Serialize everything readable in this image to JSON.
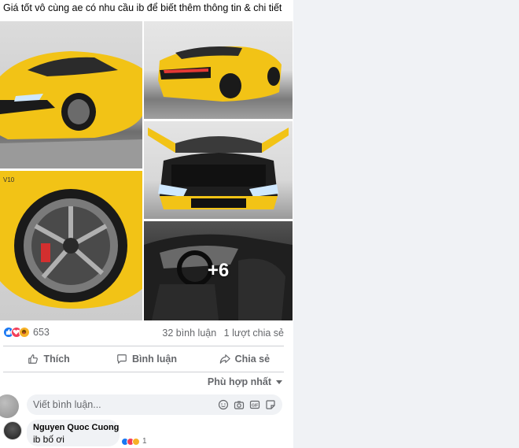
{
  "post": {
    "caption": "Giá tốt vô cùng ae có nhu cầu ib để biết thêm thông tin & chi tiết",
    "photos": [
      {
        "icon": "car-front-photo"
      },
      {
        "icon": "car-rear-photo"
      },
      {
        "icon": "car-trunk-photo"
      },
      {
        "icon": "car-wheel-photo"
      },
      {
        "icon": "car-interior-photo",
        "more_label": "+6"
      }
    ],
    "reactions": {
      "types": [
        "like",
        "love",
        "care"
      ],
      "count": "653"
    },
    "comments_count": "32 bình luận",
    "shares_count": "1 lượt chia sẻ"
  },
  "actions": {
    "like_label": "Thích",
    "comment_label": "Bình luận",
    "share_label": "Chia sẻ"
  },
  "sort": {
    "label": "Phù hợp nhất"
  },
  "comment_input": {
    "placeholder": "Viết bình luận..."
  },
  "comments": [
    {
      "author": "Nguyen Quoc Cuong",
      "text": "ib bố ơi",
      "reaction_count": "1"
    }
  ],
  "colors": {
    "accent": "#1877f2",
    "love": "#f33e58",
    "care": "#f7b125",
    "muted_text": "#65676b",
    "page_bg": "#f0f2f5"
  }
}
